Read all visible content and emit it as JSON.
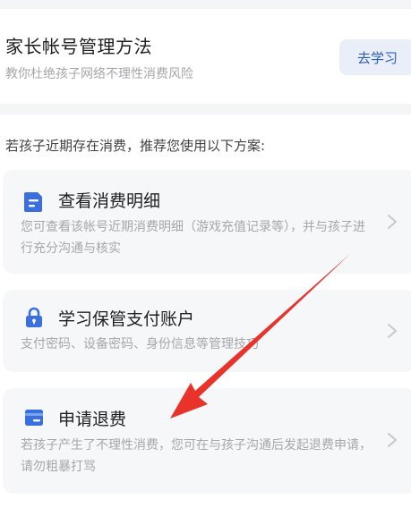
{
  "banner": {
    "title": "家长帐号管理方法",
    "subtitle": "教你杜绝孩子网络不理性消费风险",
    "button_label": "去学习"
  },
  "section": {
    "intro": "若孩子近期存在消费，推荐您使用以下方案:"
  },
  "cards": [
    {
      "title": "查看消费明细",
      "desc": "您可查看该帐号近期消费明细（游戏充值记录等），并与孩子进行充分沟通与核实",
      "icon": "document-icon"
    },
    {
      "title": "学习保管支付账户",
      "desc": "支付密码、设备密码、身份信息等管理技巧",
      "icon": "lock-icon"
    },
    {
      "title": "申请退费",
      "desc": "若孩子产生了不理性消费，您可在与孩子沟通后发起退费申请，请勿粗暴打骂",
      "icon": "wallet-icon"
    }
  ],
  "colors": {
    "accent": "#2c5fbd",
    "icon_blue": "#3a6fe0",
    "annotation_arrow": "#e8322a"
  }
}
